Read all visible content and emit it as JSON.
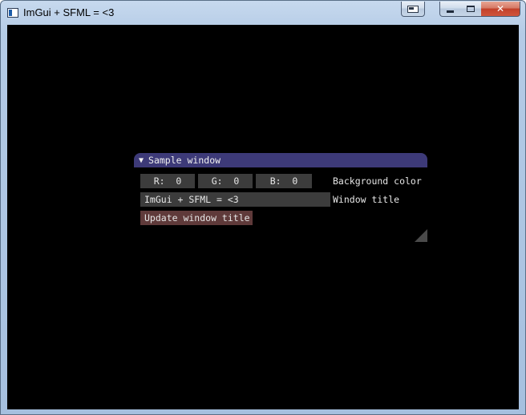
{
  "os_window": {
    "title": "ImGui + SFML = <3",
    "close_glyph": "✕"
  },
  "imgui_window": {
    "title": "Sample window",
    "collapse_arrow": "▼",
    "background_color": {
      "r_label": "R:  0",
      "g_label": "G:  0",
      "b_label": "B:  0",
      "label": "Background color"
    },
    "window_title": {
      "value": "ImGui + SFML = <3",
      "label": "Window title"
    },
    "update_button_label": "Update window title"
  },
  "colors": {
    "title_bar": "#3d3a78",
    "frame_bg": "#3c3c3c",
    "button": "#5f3a3a",
    "client_bg": "#000000"
  }
}
